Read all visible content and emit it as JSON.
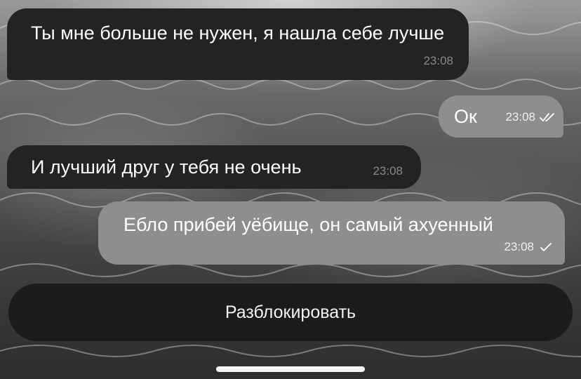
{
  "messages": [
    {
      "direction": "incoming",
      "text": "Ты мне больше не нужен, я нашла себе лучше",
      "time": "23:08",
      "status": ""
    },
    {
      "direction": "outgoing",
      "text": "Ок",
      "time": "23:08",
      "status": "read-double-check"
    },
    {
      "direction": "incoming",
      "text": "И лучший друг у тебя не очень",
      "time": "23:08",
      "status": ""
    },
    {
      "direction": "outgoing",
      "text": "Ебло прибей уёбище, он самый ахуенный",
      "time": "23:08",
      "status": "sent-single-check"
    }
  ],
  "action_button": {
    "label": "Разблокировать"
  },
  "colors": {
    "incoming_bubble": "#232323",
    "outgoing_bubble": "#8e8e8e",
    "button_background": "#1c1c1c",
    "text": "#ffffff"
  }
}
